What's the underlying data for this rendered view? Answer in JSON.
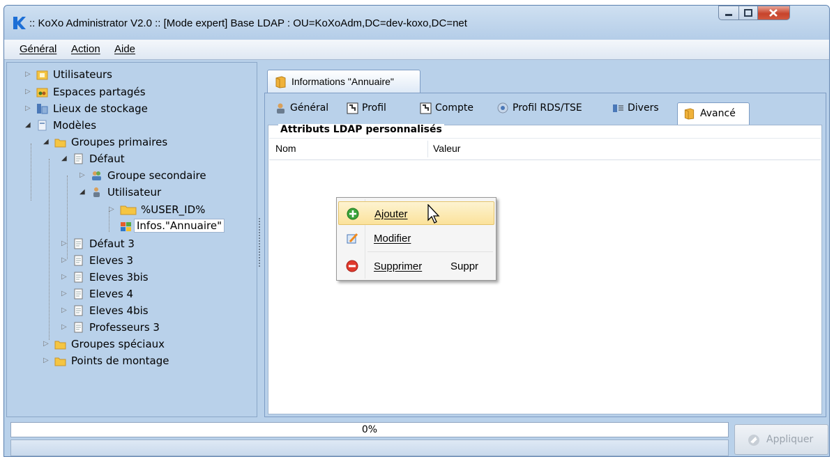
{
  "window": {
    "title": ":: KoXo Administrator V2.0 :: [Mode expert] Base LDAP : OU=KoXoAdm,DC=dev-koxo,DC=net",
    "app_icon": "koxo-logo-icon"
  },
  "menu": {
    "items": [
      {
        "label": "Général"
      },
      {
        "label": "Action"
      },
      {
        "label": "Aide"
      }
    ]
  },
  "tree": {
    "nodes": [
      {
        "label": "Utilisateurs",
        "icon": "users-folder-icon",
        "expander": "collapsed"
      },
      {
        "label": "Espaces partagés",
        "icon": "shared-spaces-icon",
        "expander": "collapsed"
      },
      {
        "label": "Lieux de stockage",
        "icon": "storage-icon",
        "expander": "collapsed"
      },
      {
        "label": "Modèles",
        "icon": "templates-icon",
        "expander": "expanded"
      },
      {
        "label": "Groupes primaires",
        "icon": "folder-icon",
        "expander": "expanded"
      },
      {
        "label": "Défaut",
        "icon": "document-icon",
        "expander": "expanded"
      },
      {
        "label": "Groupe secondaire",
        "icon": "group-icon",
        "expander": "collapsed"
      },
      {
        "label": "Utilisateur",
        "icon": "user-icon",
        "expander": "expanded"
      },
      {
        "label": "%USER_ID%",
        "icon": "folder-icon",
        "expander": "collapsed"
      },
      {
        "label": "Infos.\"Annuaire\"",
        "icon": "directory-info-icon",
        "expander": "none",
        "selected": true
      },
      {
        "label": "Défaut 3",
        "icon": "document-icon",
        "expander": "collapsed"
      },
      {
        "label": "Eleves 3",
        "icon": "document-icon",
        "expander": "collapsed"
      },
      {
        "label": "Eleves 3bis",
        "icon": "document-icon",
        "expander": "collapsed"
      },
      {
        "label": "Eleves 4",
        "icon": "document-icon",
        "expander": "collapsed"
      },
      {
        "label": "Eleves 4bis",
        "icon": "document-icon",
        "expander": "collapsed"
      },
      {
        "label": "Professeurs 3",
        "icon": "document-icon",
        "expander": "collapsed"
      },
      {
        "label": "Groupes spéciaux",
        "icon": "folder-icon",
        "expander": "collapsed"
      },
      {
        "label": "Points de montage",
        "icon": "folder-icon",
        "expander": "collapsed"
      }
    ]
  },
  "outer_tab": {
    "label": "Informations \"Annuaire\"",
    "icon": "book-icon"
  },
  "inner_tabs": [
    {
      "label": "Général",
      "icon": "user-icon"
    },
    {
      "label": "Profil",
      "icon": "profile-icon"
    },
    {
      "label": "Compte",
      "icon": "account-icon"
    },
    {
      "label": "Profil RDS/TSE",
      "icon": "rds-profile-icon"
    },
    {
      "label": "Divers",
      "icon": "misc-icon"
    },
    {
      "label": "Avancé",
      "icon": "book-icon",
      "active": true
    }
  ],
  "ldap_panel": {
    "title": "Attributs LDAP personnalisés",
    "columns": [
      "Nom",
      "Valeur"
    ]
  },
  "context_menu": {
    "items": [
      {
        "label": "Ajouter",
        "icon": "add-icon",
        "shortcut": "",
        "hovered": true
      },
      {
        "label": "Modifier",
        "icon": "edit-icon",
        "shortcut": ""
      },
      {
        "label": "Supprimer",
        "icon": "delete-icon",
        "shortcut": "Suppr"
      }
    ]
  },
  "progress": {
    "text": "0%",
    "value": 0
  },
  "apply_button": {
    "label": "Appliquer",
    "icon": "apply-icon",
    "enabled": false
  },
  "colors": {
    "window_bg": "#b9d1ea",
    "accent_hover": "#fbe29b",
    "close_button": "#c7442c",
    "folder": "#f5c542"
  }
}
